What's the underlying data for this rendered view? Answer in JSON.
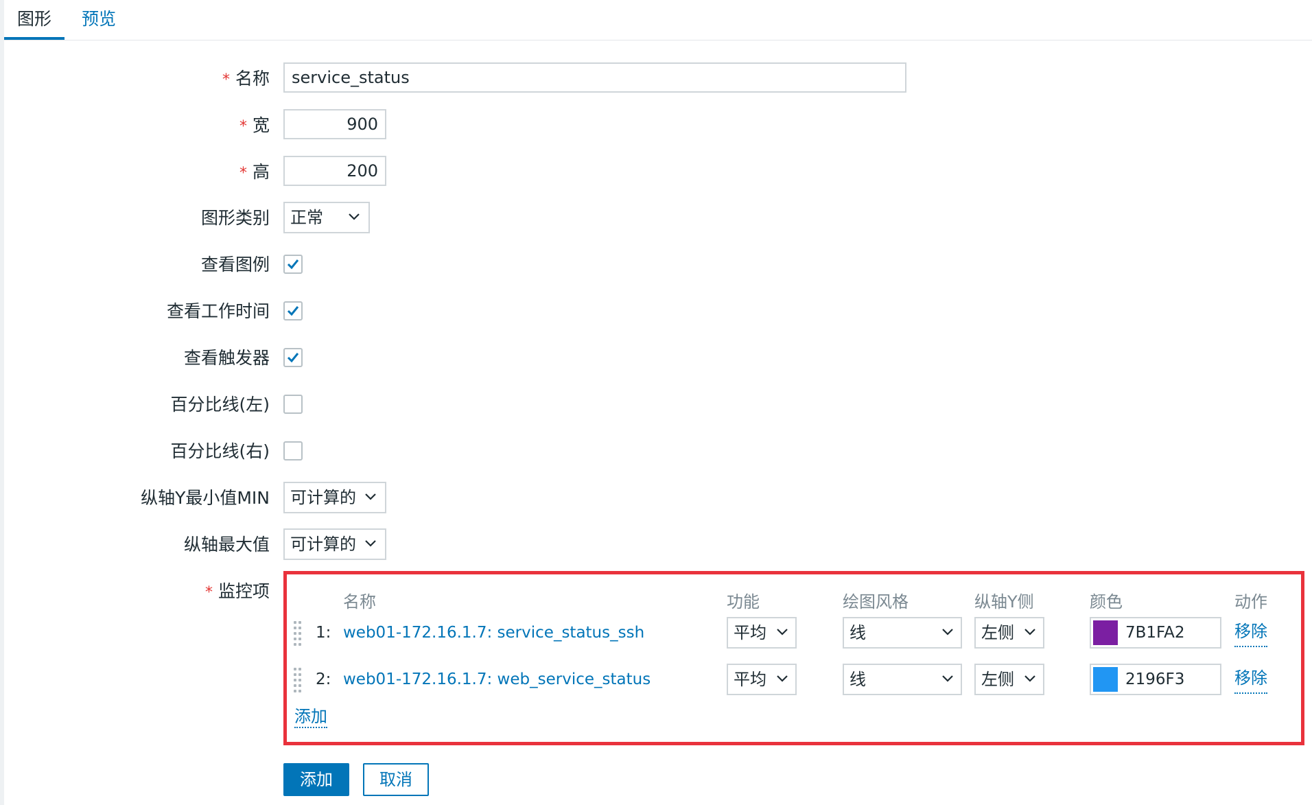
{
  "tabs": [
    {
      "label": "图形",
      "active": true
    },
    {
      "label": "预览",
      "active": false
    }
  ],
  "form": {
    "name": {
      "label": "名称",
      "required": true,
      "value": "service_status"
    },
    "width": {
      "label": "宽",
      "required": true,
      "value": "900"
    },
    "height": {
      "label": "高",
      "required": true,
      "value": "200"
    },
    "graph_type": {
      "label": "图形类别",
      "value": "正常"
    },
    "show_legend": {
      "label": "查看图例",
      "checked": true
    },
    "show_working_time": {
      "label": "查看工作时间",
      "checked": true
    },
    "show_triggers": {
      "label": "查看触发器",
      "checked": true
    },
    "percentile_left": {
      "label": "百分比线(左)",
      "checked": false
    },
    "percentile_right": {
      "label": "百分比线(右)",
      "checked": false
    },
    "y_min": {
      "label": "纵轴Y最小值MIN",
      "value": "可计算的"
    },
    "y_max": {
      "label": "纵轴最大值",
      "value": "可计算的"
    },
    "items_label": "监控项"
  },
  "items_table": {
    "headers": {
      "name": "名称",
      "function": "功能",
      "draw_style": "绘图风格",
      "y_axis_side": "纵轴Y侧",
      "color": "颜色",
      "action": "动作"
    },
    "rows": [
      {
        "index": "1:",
        "name": "web01-172.16.1.7: service_status_ssh",
        "function": "平均",
        "draw_style": "线",
        "y_axis_side": "左侧",
        "color": "7B1FA2",
        "color_hex": "#7B1FA2",
        "action": "移除"
      },
      {
        "index": "2:",
        "name": "web01-172.16.1.7: web_service_status",
        "function": "平均",
        "draw_style": "线",
        "y_axis_side": "左侧",
        "color": "2196F3",
        "color_hex": "#2196F3",
        "action": "移除"
      }
    ],
    "add_link": "添加"
  },
  "buttons": {
    "add": "添加",
    "cancel": "取消"
  },
  "colors": {
    "accent": "#0275b8",
    "required": "#e33734",
    "highlight_border": "#e9323c"
  }
}
